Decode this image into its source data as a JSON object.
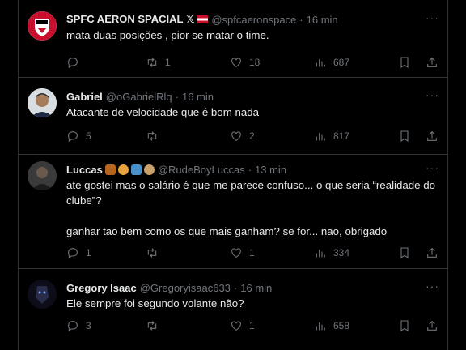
{
  "tweets": [
    {
      "name": "SPFC AERON SPACIAL 𝕏",
      "handle": "@spfcaeronspace",
      "time": "16 min",
      "text": "mata duas posições , pior se matar o time.",
      "replies": "",
      "retweets": "1",
      "likes": "18",
      "views": "687"
    },
    {
      "name": "Gabriel",
      "handle": "@oGabrielRlq",
      "time": "16 min",
      "text": "Atacante de velocidade que é bom nada",
      "replies": "5",
      "retweets": "",
      "likes": "2",
      "views": "817"
    },
    {
      "name": "Luccas",
      "handle": "@RudeBoyLuccas",
      "time": "13 min",
      "text": "ate gostei mas o salário é que me parece confuso... o que seria “realidade do clube”?\n\nganhar tao bem como os que mais ganham? se for... nao, obrigado",
      "replies": "1",
      "retweets": "",
      "likes": "1",
      "views": "334"
    },
    {
      "name": "Gregory Isaac",
      "handle": "@Gregoryisaac633",
      "time": "16 min",
      "text": "Ele sempre foi segundo volante não?",
      "replies": "3",
      "retweets": "",
      "likes": "1",
      "views": "658"
    }
  ],
  "ui": {
    "separator": "·",
    "more": "···"
  },
  "colors": {
    "background": "#000000",
    "text": "#e7e9ea",
    "muted": "#71767b",
    "border": "#2f3336"
  }
}
